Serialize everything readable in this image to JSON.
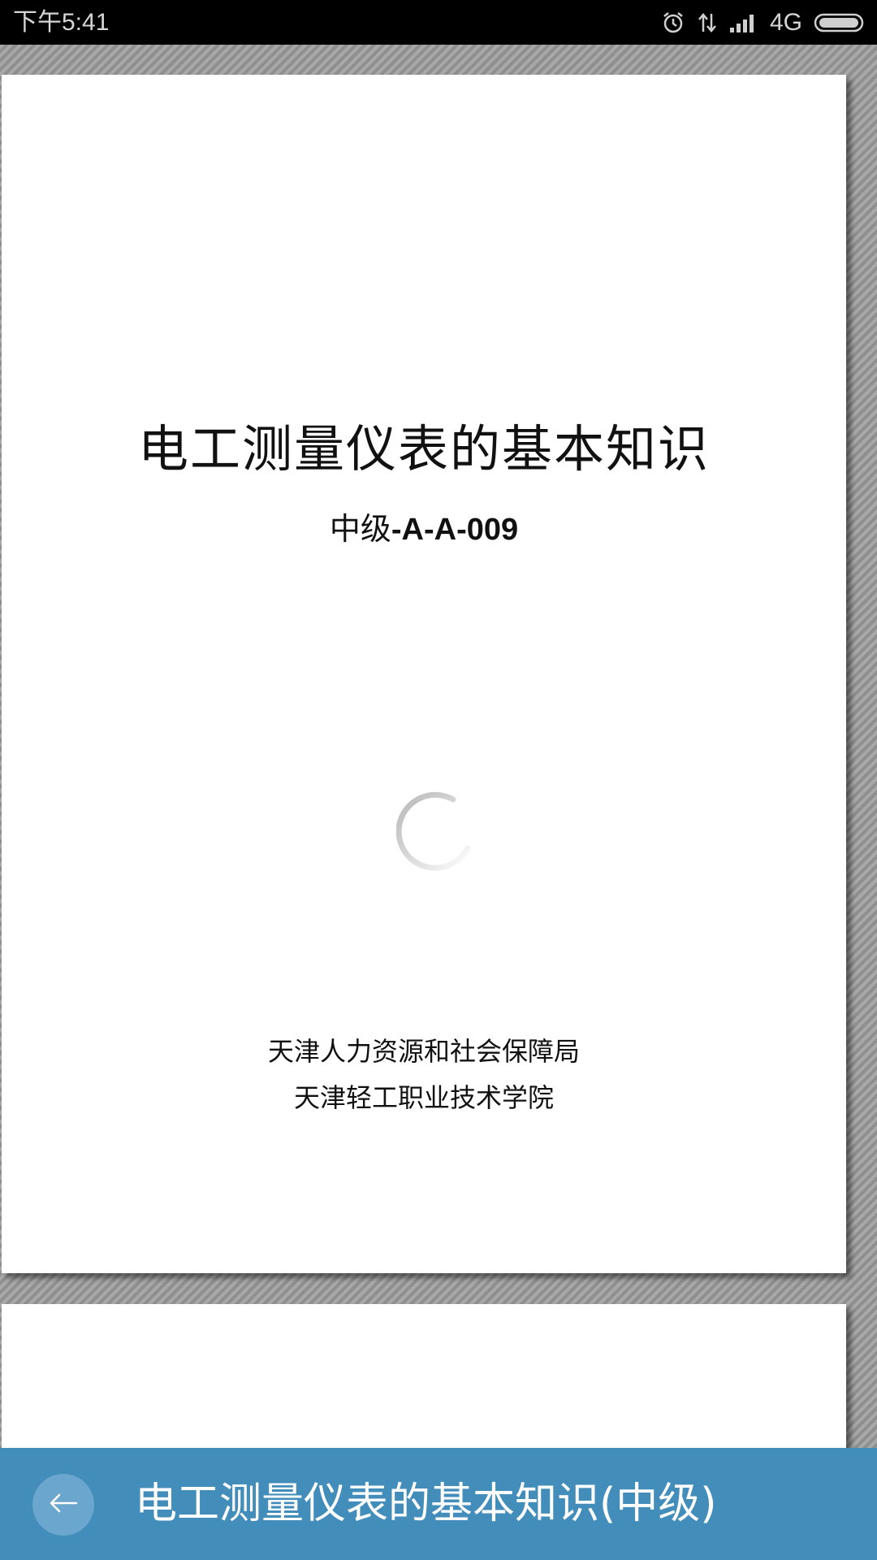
{
  "status_bar": {
    "time": "下午5:41",
    "network": "4G",
    "icons": [
      "alarm-icon",
      "data-transfer-icon",
      "signal-icon",
      "battery-icon"
    ]
  },
  "document": {
    "title": "电工测量仪表的基本知识",
    "level": "中级",
    "code": "-A-A-009",
    "issuer_1": "天津人力资源和社会保障局",
    "issuer_2": "天津轻工职业技术学院"
  },
  "bottom_bar": {
    "back_icon": "back-arrow-icon",
    "title": "电工测量仪表的基本知识(中级)",
    "color": "#438dbb"
  }
}
